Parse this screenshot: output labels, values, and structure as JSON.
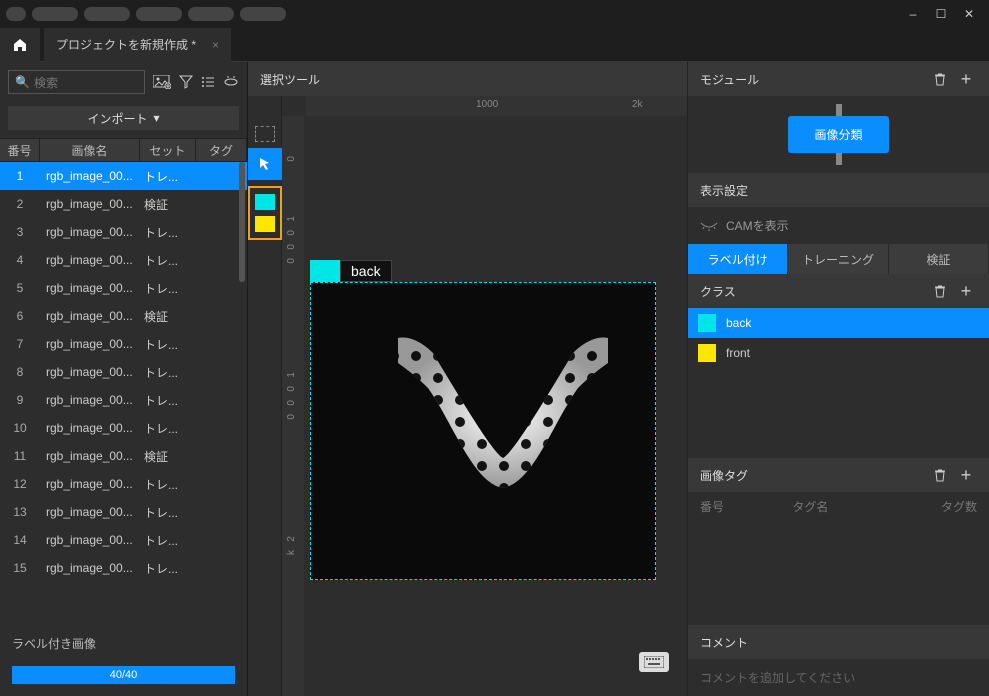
{
  "window": {
    "minimize": "–",
    "maximize": "☐",
    "close": "✕"
  },
  "tab": {
    "title": "プロジェクトを新規作成 *",
    "close": "×"
  },
  "left": {
    "search_placeholder": "検索",
    "import_label": "インポート",
    "columns": {
      "num": "番号",
      "name": "画像名",
      "set": "セット",
      "tag": "タグ"
    },
    "rows": [
      {
        "n": "1",
        "name": "rgb_image_00...",
        "set": "トレ...",
        "selected": true
      },
      {
        "n": "2",
        "name": "rgb_image_00...",
        "set": "検証"
      },
      {
        "n": "3",
        "name": "rgb_image_00...",
        "set": "トレ..."
      },
      {
        "n": "4",
        "name": "rgb_image_00...",
        "set": "トレ..."
      },
      {
        "n": "5",
        "name": "rgb_image_00...",
        "set": "トレ..."
      },
      {
        "n": "6",
        "name": "rgb_image_00...",
        "set": "検証"
      },
      {
        "n": "7",
        "name": "rgb_image_00...",
        "set": "トレ..."
      },
      {
        "n": "8",
        "name": "rgb_image_00...",
        "set": "トレ..."
      },
      {
        "n": "9",
        "name": "rgb_image_00...",
        "set": "トレ..."
      },
      {
        "n": "10",
        "name": "rgb_image_00...",
        "set": "トレ..."
      },
      {
        "n": "11",
        "name": "rgb_image_00...",
        "set": "検証"
      },
      {
        "n": "12",
        "name": "rgb_image_00...",
        "set": "トレ..."
      },
      {
        "n": "13",
        "name": "rgb_image_00...",
        "set": "トレ..."
      },
      {
        "n": "14",
        "name": "rgb_image_00...",
        "set": "トレ..."
      },
      {
        "n": "15",
        "name": "rgb_image_00...",
        "set": "トレ..."
      }
    ],
    "labeled_label": "ラベル付き画像",
    "progress": "40/40"
  },
  "center": {
    "title": "選択ツール",
    "ruler_1000": "1000",
    "ruler_2k": "2k",
    "ruler_v0a": "0",
    "ruler_v1a": "1",
    "ruler_v0b": "0",
    "ruler_v0c": "0",
    "ruler_v0d": "0",
    "ruler_v1b": "1",
    "ruler_v0e": "0",
    "ruler_v0f": "0",
    "ruler_v0g": "0",
    "ruler_v2": "2",
    "ruler_vk": "k",
    "chip_label": "back",
    "swatches": {
      "cyan": "#00e5e5",
      "yellow": "#ffe600"
    }
  },
  "right": {
    "module_title": "モジュール",
    "module_button": "画像分類",
    "display_title": "表示設定",
    "cam_label": "CAMを表示",
    "tabs": {
      "label": "ラベル付け",
      "train": "トレーニング",
      "valid": "検証"
    },
    "class_title": "クラス",
    "classes": [
      {
        "name": "back",
        "color": "#00e5e5",
        "selected": true
      },
      {
        "name": "front",
        "color": "#ffe600"
      }
    ],
    "imagetag_title": "画像タグ",
    "tag_cols": {
      "num": "番号",
      "name": "タグ名",
      "count": "タグ数"
    },
    "comment_title": "コメント",
    "comment_placeholder": "コメントを追加してください"
  }
}
